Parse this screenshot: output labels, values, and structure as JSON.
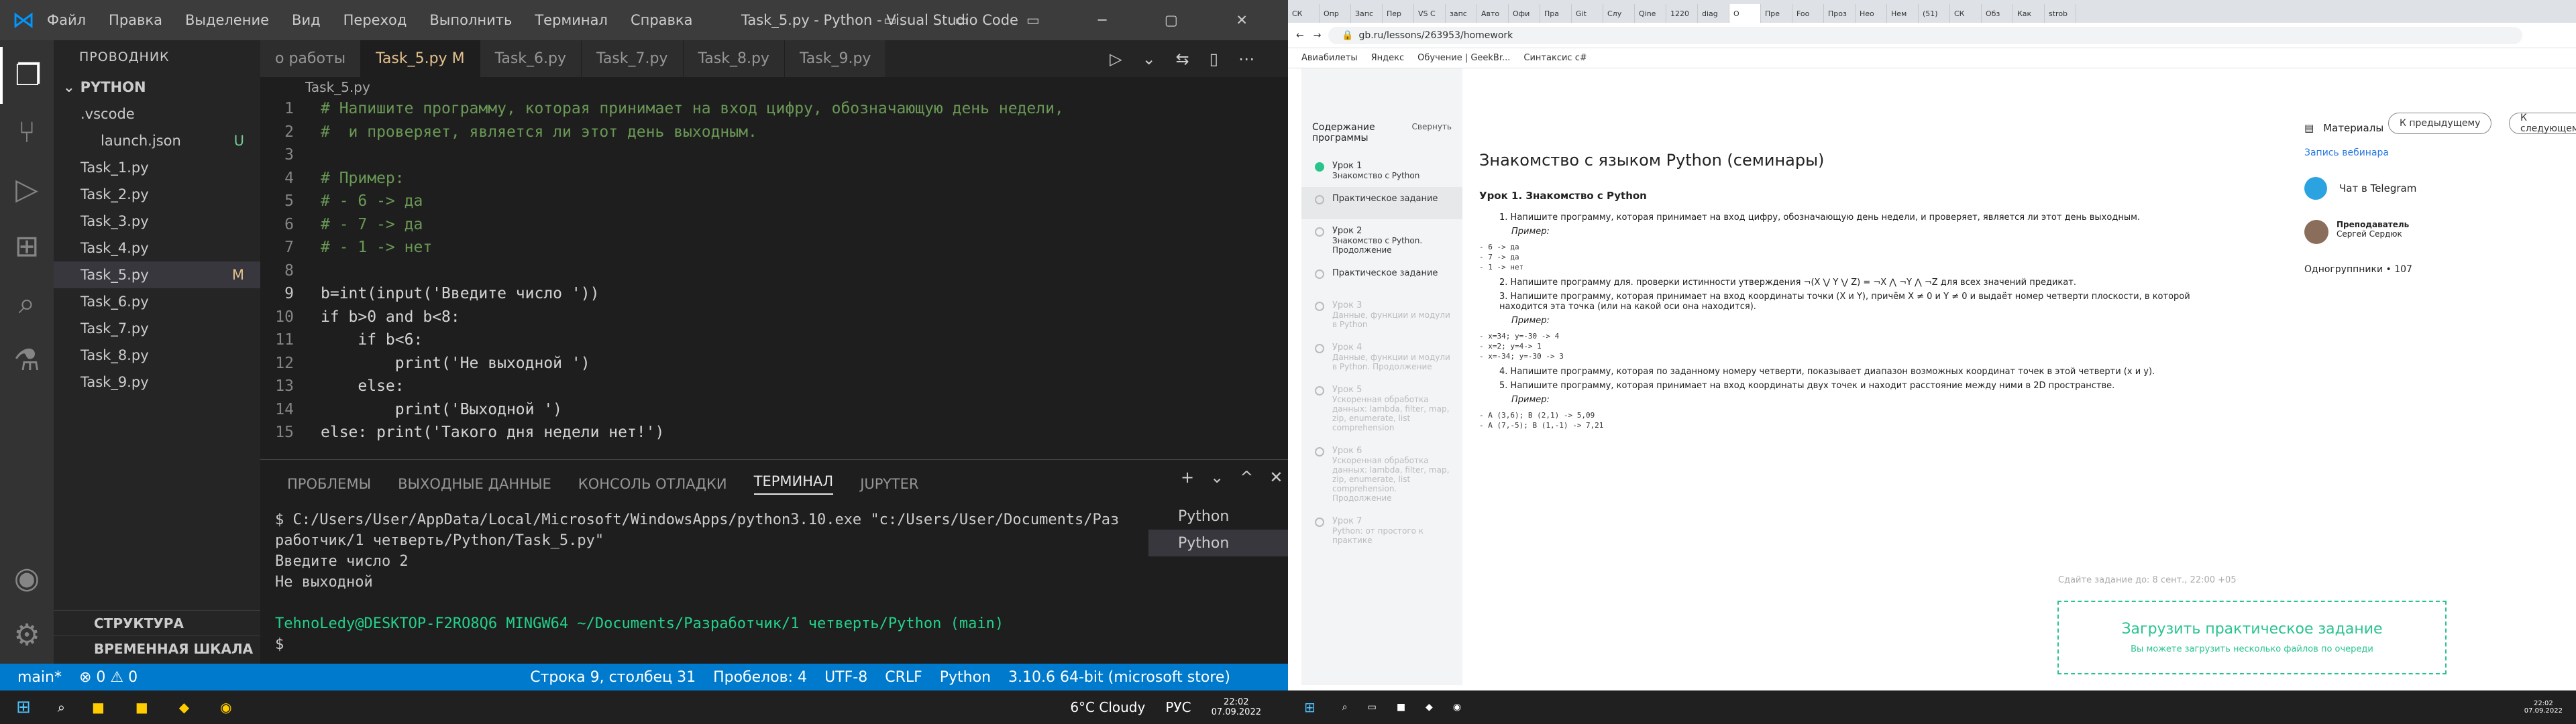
{
  "vscode": {
    "menu": [
      "Файл",
      "Правка",
      "Выделение",
      "Вид",
      "Переход",
      "Выполнить",
      "Терминал",
      "Справка"
    ],
    "title": "Task_5.py - Python - Visual Studio Code",
    "explorer_header": "ПРОВОДНИК",
    "project": "PYTHON",
    "files": [
      {
        "name": ".vscode",
        "status": "",
        "selected": false
      },
      {
        "name": "launch.json",
        "status": "U",
        "selected": false
      },
      {
        "name": "Task_1.py",
        "status": "",
        "selected": false
      },
      {
        "name": "Task_2.py",
        "status": "",
        "selected": false
      },
      {
        "name": "Task_3.py",
        "status": "",
        "selected": false
      },
      {
        "name": "Task_4.py",
        "status": "",
        "selected": false
      },
      {
        "name": "Task_5.py",
        "status": "M",
        "selected": true
      },
      {
        "name": "Task_6.py",
        "status": "",
        "selected": false
      },
      {
        "name": "Task_7.py",
        "status": "",
        "selected": false
      },
      {
        "name": "Task_8.py",
        "status": "",
        "selected": false
      },
      {
        "name": "Task_9.py",
        "status": "",
        "selected": false
      }
    ],
    "tabs": [
      "о работы",
      "Task_5.py M",
      "Task_6.py",
      "Task_7.py",
      "Task_8.py",
      "Task_9.py"
    ],
    "breadcrumb": "Task_5.py",
    "code": [
      "# Напишите программу, которая принимает на вход цифру, обозначающую день недели,",
      "#  и проверяет, является ли этот день выходным.",
      "",
      "# Пример:",
      "# - 6 -> да",
      "# - 7 -> да",
      "# - 1 -> нет",
      "",
      "b=int(input('Введите число '))",
      "if b>0 and b<8:",
      "    if b<6:",
      "        print('Не выходной ')",
      "    else:",
      "        print('Выходной ')",
      "else: print('Такого дня недели нет!')"
    ],
    "panel_tabs": [
      "ПРОБЛЕМЫ",
      "ВЫХОДНЫЕ ДАННЫЕ",
      "КОНСОЛЬ ОТЛАДКИ",
      "ТЕРМИНАЛ",
      "JUPYTER"
    ],
    "terminal": [
      "$ C:/Users/User/AppData/Local/Microsoft/WindowsApps/python3.10.exe \"c:/Users/User/Documents/Раз",
      "работчик/1 четверть/Python/Task_5.py\"",
      "Введите число 2",
      "Не выходной",
      "",
      "TehnoLedy@DESKTOP-F2RO8Q6 MINGW64 ~/Documents/Разработчик/1 четверть/Python (main)",
      "$ "
    ],
    "terminal_list": [
      "Python",
      "Python"
    ],
    "outline": [
      "СТРУКТУРА",
      "ВРЕМЕННАЯ ШКАЛА"
    ],
    "status": [
      "main*",
      "⊗ 0 ⚠ 0",
      "Строка 9, столбец 31",
      "Пробелов: 4",
      "UTF-8",
      "CRLF",
      "Python",
      "3.10.6 64-bit (microsoft store)"
    ]
  },
  "browser": {
    "url": "gb.ru/lessons/263953/homework",
    "tabs": [
      "СК",
      "Опр",
      "Запс",
      "Пер",
      "VS C",
      "запс",
      "Авто",
      "Офи",
      "Пра",
      "Git",
      "Слу",
      "Qine",
      "1220",
      "diag",
      "О",
      "Пре",
      "Foo",
      "Проз",
      "Нео",
      "Нем",
      "(51)",
      "СК",
      "Обз",
      "Как",
      "strob"
    ],
    "bookmarks": [
      "Авиабилеты",
      "Яндекс",
      "Обучение | GeekBr...",
      "Синтаксис c#"
    ],
    "sidebar_title": "Содержание программы",
    "collapse": "Свернуть",
    "lessons": [
      {
        "title": "Урок 1",
        "sub": "Знакомство с Python",
        "state": "done"
      },
      {
        "title": "Практическое задание",
        "sub": "",
        "state": "hl"
      },
      {
        "title": "Урок 2",
        "sub": "Знакомство с Python. Продолжение",
        "state": "normal"
      },
      {
        "title": "Практическое задание",
        "sub": "",
        "state": "normal"
      },
      {
        "title": "Урок 3",
        "sub": "Данные, функции и модули в Python",
        "state": "dim"
      },
      {
        "title": "Урок 4",
        "sub": "Данные, функции и модули в Python. Продолжение",
        "state": "dim"
      },
      {
        "title": "Урок 5",
        "sub": "Ускоренная обработка данных: lambda, filter, map, zip, enumerate, list comprehension",
        "state": "dim"
      },
      {
        "title": "Урок 6",
        "sub": "Ускоренная обработка данных: lambda, filter, map, zip, enumerate, list comprehension. Продолжение",
        "state": "dim"
      },
      {
        "title": "Урок 7",
        "sub": "Python: от простого к практике",
        "state": "dim"
      }
    ],
    "prev": "К предыдущему",
    "next": "К следующему",
    "heading": "Знакомство с языком Python (семинары)",
    "lesson_title": "Урок 1. Знакомство с Python",
    "tasks": [
      "Напишите программу, которая принимает на вход цифру, обозначающую день недели, и проверяет, является ли этот день выходным.",
      "Напишите программу для. проверки истинности утверждения ¬(X ⋁ Y ⋁ Z) = ¬X ⋀ ¬Y ⋀ ¬Z для всех значений предикат.",
      "Напишите программу, которая принимает на вход координаты точки (X и Y), причём X ≠ 0 и Y ≠ 0 и выдаёт номер четверти плоскости, в которой находится эта точка (или на какой оси она находится).",
      "Напишите программу, которая по заданному номеру четверти, показывает диапазон возможных координат точек в этой четверти (x и y).",
      "Напишите программу, которая принимает на вход координаты двух точек и находит расстояние между ними в 2D пространстве."
    ],
    "example_label": "Пример:",
    "ex1": "- 6 -> да\n- 7 -> да\n- 1 -> нет",
    "ex2": "- x=34; y=-30 -> 4\n- x=2; y=4-> 1\n- x=-34; y=-30 -> 3",
    "ex3": "- A (3,6); B (2,1) -> 5,09\n- A (7,-5); B (1,-1) -> 7,21",
    "deadline": "Сдайте задание до: 8 сент., 22:00 +05",
    "upload_title": "Загрузить практическое задание",
    "upload_sub": "Вы можете загрузить несколько файлов по очереди",
    "materials": "Материалы",
    "webinar": "Запись вебинара",
    "telegram": "Чат в Telegram",
    "teacher_label": "Преподаватель",
    "teacher": "Сергей Сердюк",
    "groupmates": "Одногруппники • 107"
  },
  "taskbar_left": {
    "weather": "6°C  Cloudy",
    "lang": "РУС",
    "time": "22:02",
    "date": "07.09.2022"
  },
  "taskbar_right": {
    "time": "22:02",
    "date": "07.09.2022"
  }
}
